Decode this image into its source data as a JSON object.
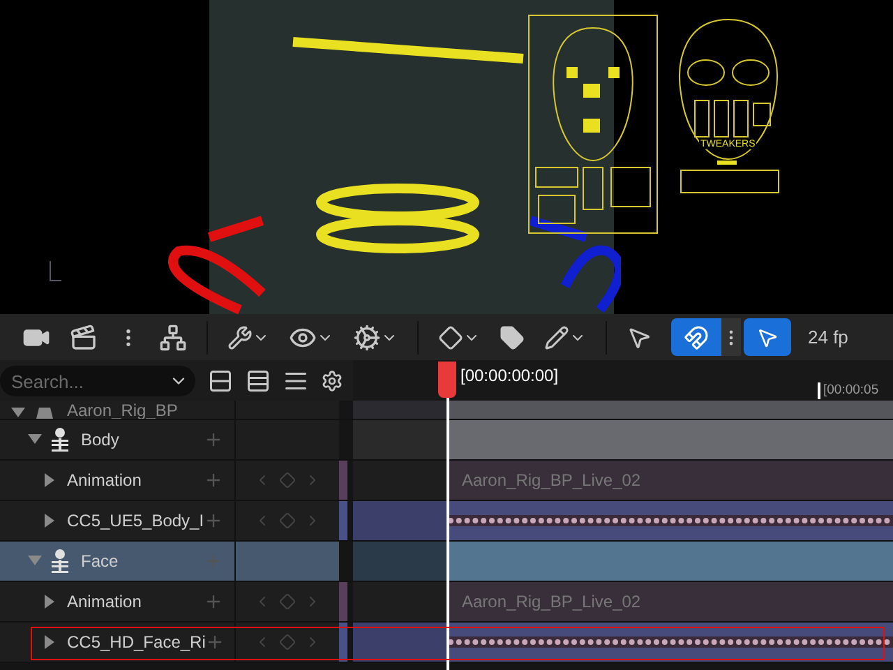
{
  "viewport": {
    "panel_label": "TWEAKERS"
  },
  "toolbar": {
    "toggles": [
      {
        "on": true
      },
      {
        "on": true
      }
    ],
    "fps_label": "24 fp"
  },
  "search": {
    "placeholder": "Search..."
  },
  "timeline": {
    "playhead_time": "[00:00:00:00]",
    "tick_label": "[00:00:05"
  },
  "tracks": [
    {
      "kind": "object",
      "label": "Aaron_Rig_BP",
      "selected": false,
      "expanded": true,
      "children": [
        {
          "kind": "group",
          "label": "Body",
          "selected": false,
          "expanded": true,
          "children": [
            {
              "kind": "animation",
              "label": "Animation",
              "selected": false,
              "expanded": false,
              "section": "Aaron_Rig_BP_Live_02"
            },
            {
              "kind": "skeletal",
              "label": "CC5_UE5_Body_I",
              "selected": false,
              "expanded": false
            }
          ]
        },
        {
          "kind": "group",
          "label": "Face",
          "selected": true,
          "expanded": true,
          "children": [
            {
              "kind": "animation",
              "label": "Animation",
              "selected": false,
              "expanded": false,
              "section": "Aaron_Rig_BP_Live_02"
            },
            {
              "kind": "skeletal",
              "label": "CC5_HD_Face_Ri",
              "selected": false,
              "expanded": false
            }
          ]
        }
      ]
    }
  ]
}
